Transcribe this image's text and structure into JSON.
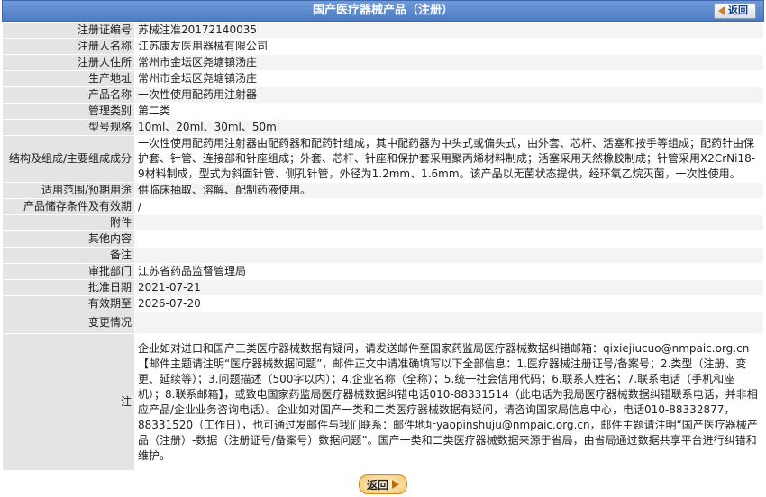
{
  "header": {
    "title": "国产医疗器械产品（注册）",
    "back_label": "返回"
  },
  "rows": [
    {
      "key": "注册证编号",
      "value": "苏械注准20172140035"
    },
    {
      "key": "注册人名称",
      "value": "江苏康友医用器械有限公司"
    },
    {
      "key": "注册人住所",
      "value": "常州市金坛区尧塘镇汤庄"
    },
    {
      "key": "生产地址",
      "value": "常州市金坛区尧塘镇汤庄"
    },
    {
      "key": "产品名称",
      "value": "一次性使用配药用注射器"
    },
    {
      "key": "管理类别",
      "value": "第二类"
    },
    {
      "key": "型号规格",
      "value": "10ml、20ml、30ml、50ml"
    },
    {
      "key": "结构及组成/主要组成成分",
      "value": "一次性使用配药用注射器由配药器和配药针组成，其中配药器为中头式或偏头式，由外套、芯杆、活塞和按手等组成；配药针由保护套、针管、连接部和针座组成；外套、芯杆、针座和保护套采用聚丙烯材料制成；活塞采用天然橡胶制成；针管采用X2CrNi18-9材料制成，型式为斜面针管、侧孔针管，外径为1.2mm、1.6mm。该产品以无菌状态提供，经环氧乙烷灭菌，一次性使用。"
    },
    {
      "key": "适用范围/预期用途",
      "value": "供临床抽取、溶解、配制药液使用。"
    },
    {
      "key": "产品储存条件及有效期",
      "value": "/"
    },
    {
      "key": "附件",
      "value": ""
    },
    {
      "key": "其他内容",
      "value": ""
    },
    {
      "key": "备注",
      "value": ""
    },
    {
      "key": "审批部门",
      "value": "江苏省药品监督管理局"
    },
    {
      "key": "批准日期",
      "value": "2021-07-21"
    },
    {
      "key": "有效期至",
      "value": "2026-07-20"
    },
    {
      "key": "变更情况",
      "value": ""
    },
    {
      "key": "注",
      "value": "企业如对进口和国产三类医疗器械数据有疑问，请发送邮件至国家药监局医疗器械数据纠错邮箱：qixiejiucuo@nmpaic.org.cn【邮件主题请注明“医疗器械数据问题”，邮件正文中请准确填写以下全部信息：1.医疗器械注册证号/备案号；2.类型（注册、变更、延续等）；3.问题描述（500字以内）；4.企业名称（全称）；5.统一社会信用代码；6.联系人姓名；7.联系电话（手机和座机）；8.联系邮箱】，或致电国家药监局医疗器械数据纠错电话010-88331514（此电话为我局医疗器械数据纠错联系电话，并非相应产品/企业业务咨询电话）。企业如对国产一类和二类医疗器械数据有疑问，请咨询国家局信息中心，电话010-88332877，88331520（工作日），也可通过发邮件与我们联系：邮件地址yaopinshuju@nmpaic.org.cn，邮件主题请注明“国产医疗器械产品（注册）-数据（注册证号/备案号）数据问题”。国产一类和二类医疗器械数据来源于省局，由省局通过数据共享平台进行纠错和维护。"
    }
  ],
  "footer": {
    "back_label": "返回"
  }
}
